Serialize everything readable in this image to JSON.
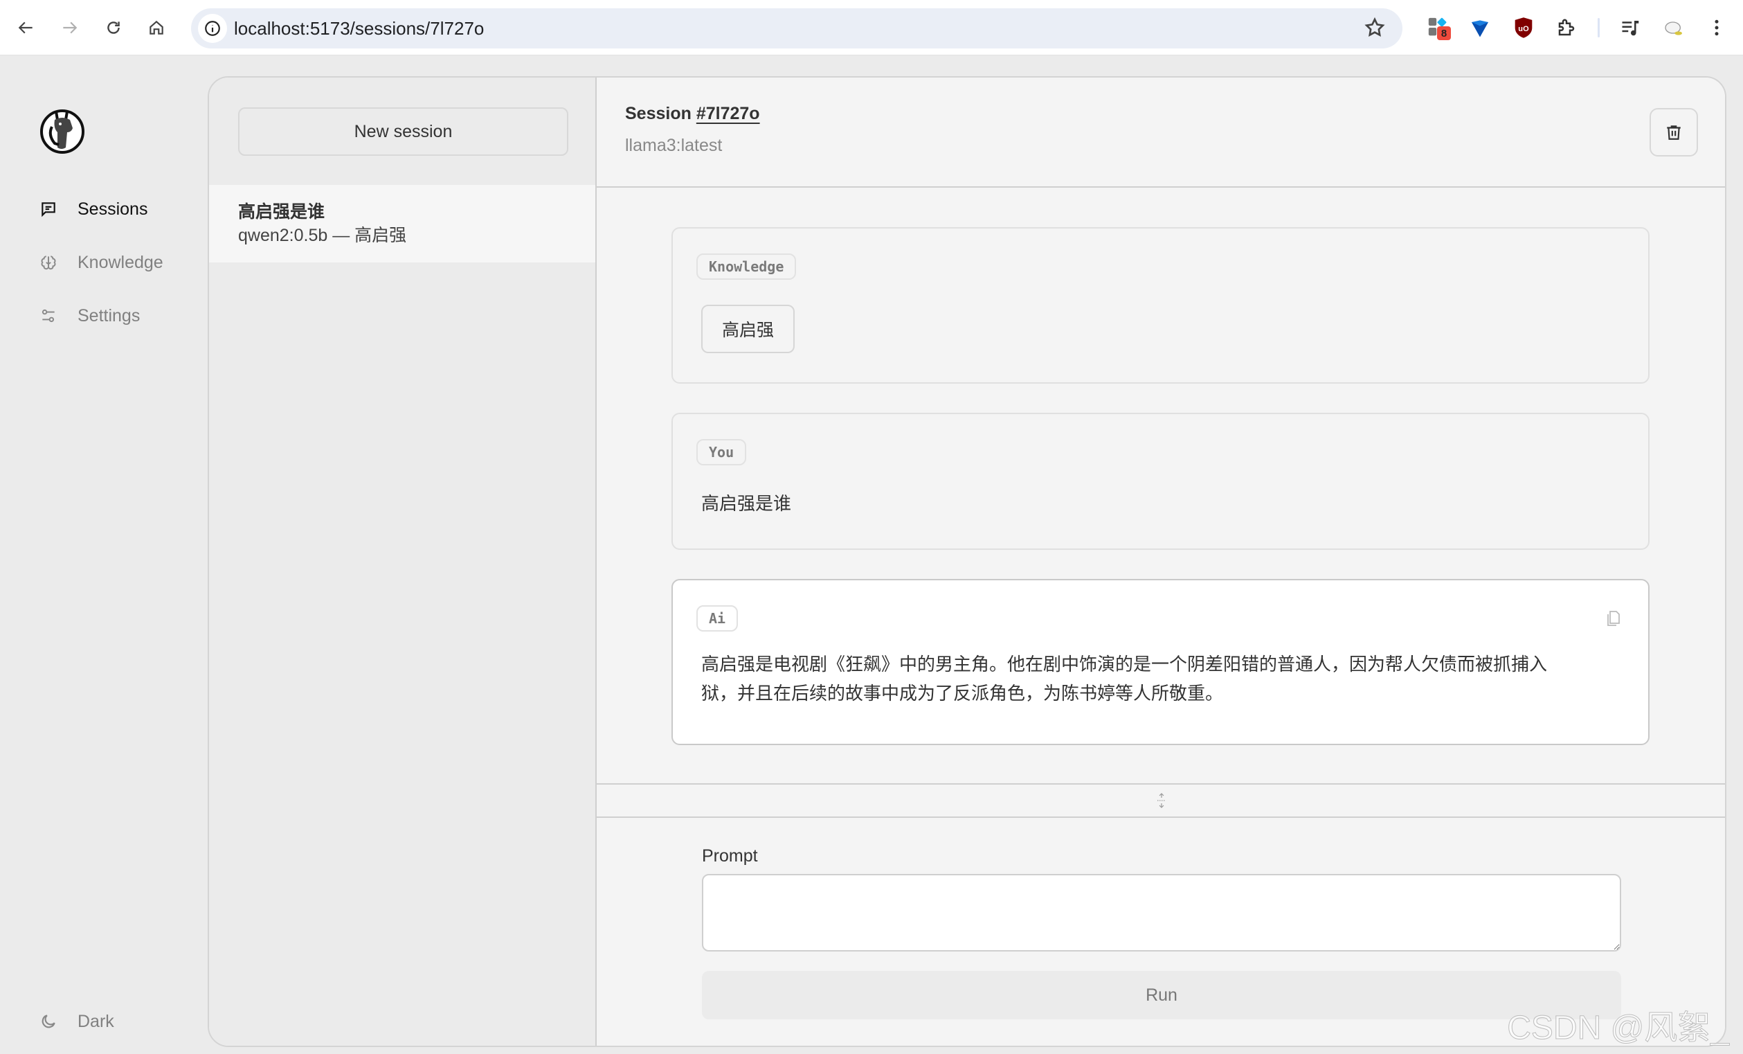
{
  "browser": {
    "url": "localhost:5173/sessions/7l727o",
    "extension_badge": "8"
  },
  "nav": {
    "items": [
      {
        "label": "Sessions",
        "icon": "chat-icon",
        "active": true
      },
      {
        "label": "Knowledge",
        "icon": "brain-icon",
        "active": false
      },
      {
        "label": "Settings",
        "icon": "sliders-icon",
        "active": false
      }
    ],
    "theme_toggle": {
      "label": "Dark",
      "icon": "moon-icon"
    }
  },
  "sessions": {
    "new_session_label": "New session",
    "items": [
      {
        "title": "高启强是谁",
        "subtitle": "qwen2:0.5b — 高启强",
        "active": true
      }
    ]
  },
  "session": {
    "title_prefix": "Session",
    "id": "#7l727o",
    "model": "llama3:latest"
  },
  "messages": [
    {
      "role_tag": "Knowledge",
      "chips": [
        "高启强"
      ]
    },
    {
      "role_tag": "You",
      "text": "高启强是谁"
    },
    {
      "role_tag": "Ai",
      "text_lines": [
        "高启强是电视剧《狂飙》中的男主角。他在剧中饰演的是一个阴差阳错的普通人，因为帮人欠债而被抓捕入",
        "狱，并且在后续的故事中成为了反派角色，为陈书婷等人所敬重。"
      ]
    }
  ],
  "composer": {
    "label": "Prompt",
    "value": "",
    "run_label": "Run"
  },
  "watermark": "CSDN @风絮_"
}
